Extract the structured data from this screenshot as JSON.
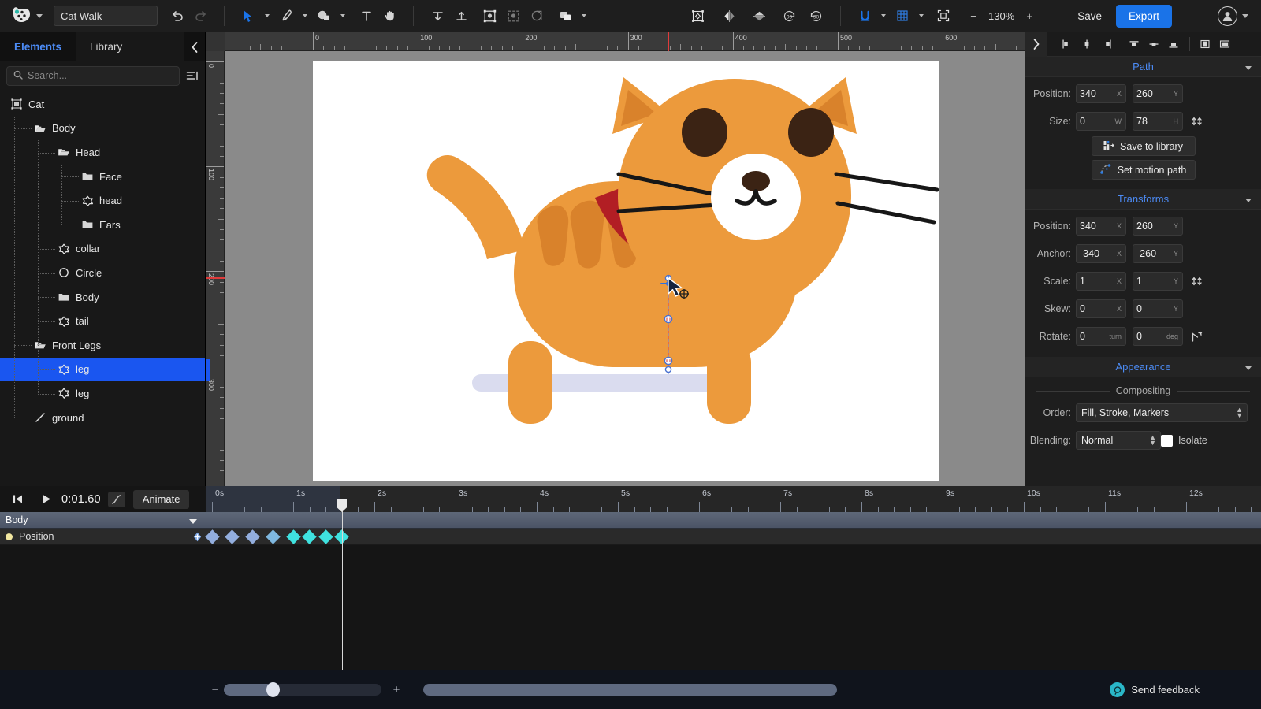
{
  "app": {
    "title": "Cat Walk",
    "logo_icon": "app-logo-icon"
  },
  "topbar": {
    "undo_icon": "undo-icon",
    "redo_icon": "redo-icon",
    "tools": [
      {
        "name": "select-tool",
        "icon": "cursor-arrow-icon",
        "has_caret": true
      },
      {
        "name": "pen-tool",
        "icon": "pen-nib-icon",
        "has_caret": true
      },
      {
        "name": "shape-tool",
        "icon": "shapes-icon",
        "has_caret": true
      },
      {
        "name": "text-tool",
        "icon": "text-T-icon",
        "has_caret": false
      },
      {
        "name": "hand-tool",
        "icon": "hand-icon",
        "has_caret": false
      }
    ],
    "arrange": [
      {
        "name": "align-top-tool",
        "icon": "align-top-icon"
      },
      {
        "name": "align-bottom-tool",
        "icon": "align-bottom-icon"
      },
      {
        "name": "group-tool",
        "icon": "group-frame-icon"
      },
      {
        "name": "ungroup-tool",
        "icon": "ungroup-icon"
      },
      {
        "name": "mask-tool",
        "icon": "mask-circle-icon"
      },
      {
        "name": "boolean-tool",
        "icon": "boolean-union-icon",
        "has_caret": true
      }
    ],
    "transform": [
      {
        "name": "transform-tool",
        "icon": "transform-box-icon"
      },
      {
        "name": "flip-horizontal-tool",
        "icon": "flip-horizontal-icon"
      },
      {
        "name": "flip-vertical-tool",
        "icon": "flip-vertical-icon"
      },
      {
        "name": "rotate-ccw-90-tool",
        "icon": "rotate-left-90-icon"
      },
      {
        "name": "rotate-cw-90-tool",
        "icon": "rotate-right-90-icon"
      }
    ],
    "snap": {
      "name": "snap-tool",
      "icon": "magnet-U-icon",
      "has_caret": true
    },
    "grid": {
      "name": "grid-tool",
      "icon": "grid-icon",
      "has_caret": true
    },
    "fit": {
      "name": "fit-to-screen-tool",
      "icon": "fit-screen-icon"
    },
    "zoom_out_label": "−",
    "zoom_level": "130%",
    "zoom_in_label": "+",
    "save_label": "Save",
    "export_label": "Export",
    "account_icon": "user-avatar-icon"
  },
  "sidebar": {
    "tabs": [
      {
        "label": "Elements",
        "active": true
      },
      {
        "label": "Library",
        "active": false
      }
    ],
    "collapse_icon": "chevron-left-icon",
    "search": {
      "placeholder": "Search...",
      "value": "",
      "icon": "search-icon"
    },
    "filter_icon": "filter-list-icon",
    "tree": [
      {
        "label": "Cat",
        "depth": 0,
        "icon": "artboard-icon",
        "selected": false
      },
      {
        "label": "Body",
        "depth": 1,
        "icon": "folder-open-icon",
        "selected": false
      },
      {
        "label": "Head",
        "depth": 2,
        "icon": "folder-open-icon",
        "selected": false
      },
      {
        "label": "Face",
        "depth": 3,
        "icon": "folder-icon",
        "selected": false
      },
      {
        "label": "head",
        "depth": 3,
        "icon": "path-star-icon",
        "selected": false
      },
      {
        "label": "Ears",
        "depth": 3,
        "icon": "folder-icon",
        "selected": false
      },
      {
        "label": "collar",
        "depth": 2,
        "icon": "path-star-icon",
        "selected": false
      },
      {
        "label": "Circle",
        "depth": 2,
        "icon": "circle-icon",
        "selected": false
      },
      {
        "label": "Body",
        "depth": 2,
        "icon": "folder-icon",
        "selected": false
      },
      {
        "label": "tail",
        "depth": 2,
        "icon": "path-star-icon",
        "selected": false
      },
      {
        "label": "Front Legs",
        "depth": 1,
        "icon": "folder-open-icon",
        "selected": false
      },
      {
        "label": "leg",
        "depth": 2,
        "icon": "path-star-icon",
        "selected": true
      },
      {
        "label": "leg",
        "depth": 2,
        "icon": "path-star-icon",
        "selected": false
      },
      {
        "label": "ground",
        "depth": 1,
        "icon": "line-icon",
        "selected": false
      }
    ]
  },
  "canvas": {
    "ruler_h_labels": [
      "0",
      "100",
      "200",
      "300",
      "400",
      "500",
      "600"
    ],
    "ruler_v_labels": [
      "0",
      "100",
      "200",
      "300"
    ],
    "background_color": "#8a8a8a",
    "artboard_color": "#ffffff",
    "guide_color": "#e03b3b"
  },
  "artwork": {
    "name": "cat-illustration",
    "colors": {
      "body": "#EC9A3C",
      "stripe": "#D9822B",
      "ear_inner": "#D9822B",
      "muzzle": "#FFFFFF",
      "eye": "#3B2314",
      "nose": "#3B2314",
      "collar": "#B21E24",
      "bell": "#FFD53E",
      "ground_shadow": "#DADCEF",
      "whisker": "#171717"
    }
  },
  "properties": {
    "panel_toolbar": {
      "expand_icon": "chevron-right-icon",
      "align_buttons": [
        {
          "name": "align-left-icon"
        },
        {
          "name": "align-center-horizontal-icon"
        },
        {
          "name": "align-right-icon"
        },
        {
          "name": "align-top-icon"
        },
        {
          "name": "align-middle-vertical-icon"
        },
        {
          "name": "align-bottom-icon"
        },
        {
          "name": "distribute-horizontal-icon"
        },
        {
          "name": "distribute-vertical-icon"
        }
      ]
    },
    "path": {
      "title": "Path",
      "position_label": "Position:",
      "position_x": "340",
      "position_x_unit": "X",
      "position_y": "260",
      "position_y_unit": "Y",
      "size_label": "Size:",
      "size_w": "0",
      "size_w_unit": "W",
      "size_h": "78",
      "size_h_unit": "H",
      "link_icon": "link-ratio-icon",
      "save_to_library_label": "Save to library",
      "save_to_library_icon": "save-library-icon",
      "set_motion_path_label": "Set motion path",
      "set_motion_path_icon": "motion-path-icon"
    },
    "transforms": {
      "title": "Transforms",
      "position_label": "Position:",
      "position_x": "340",
      "position_x_unit": "X",
      "position_y": "260",
      "position_y_unit": "Y",
      "anchor_label": "Anchor:",
      "anchor_x": "-340",
      "anchor_x_unit": "X",
      "anchor_y": "-260",
      "anchor_y_unit": "Y",
      "scale_label": "Scale:",
      "scale_x": "1",
      "scale_x_unit": "X",
      "scale_y": "1",
      "scale_y_unit": "Y",
      "scale_link_icon": "link-ratio-icon",
      "skew_label": "Skew:",
      "skew_x": "0",
      "skew_x_unit": "X",
      "skew_y": "0",
      "skew_y_unit": "Y",
      "rotate_label": "Rotate:",
      "rotate_turn": "0",
      "rotate_turn_unit": "turn",
      "rotate_deg": "0",
      "rotate_deg_unit": "deg",
      "rotate_icon": "rotate-anchor-icon"
    },
    "appearance": {
      "title": "Appearance",
      "compositing_label": "Compositing",
      "order_label": "Order:",
      "order_value": "Fill, Stroke, Markers",
      "blending_label": "Blending:",
      "blending_value": "Normal",
      "isolate_label": "Isolate",
      "isolate_checked": false
    }
  },
  "timeline": {
    "skip_start_icon": "skip-to-start-icon",
    "play_icon": "play-icon",
    "timecode": "0:01.60",
    "easing_icon": "easing-curve-icon",
    "animate_label": "Animate",
    "ruler_labels": [
      "0s",
      "1s",
      "2s",
      "3s",
      "4s",
      "5s",
      "6s",
      "7s",
      "8s",
      "9s",
      "10s",
      "11s",
      "12s"
    ],
    "playhead_time": "1.60",
    "group_track": {
      "label": "Body",
      "collapse_icon": "chevron-down-icon"
    },
    "property_track": {
      "label": "Position",
      "dot_color": "#f2e7a0",
      "nav_icon": "keyframe-nav-icon",
      "keyframes": [
        {
          "t": 0.0,
          "color": "#93aede"
        },
        {
          "t": 0.25,
          "color": "#93aede"
        },
        {
          "t": 0.5,
          "color": "#93aede"
        },
        {
          "t": 0.75,
          "color": "#7fb8e0"
        },
        {
          "t": 1.0,
          "color": "#3fe2e0"
        },
        {
          "t": 1.2,
          "color": "#3fe2e0"
        },
        {
          "t": 1.4,
          "color": "#3fe2e0"
        },
        {
          "t": 1.6,
          "color": "#3fe2e0"
        }
      ]
    }
  },
  "bottombar": {
    "zoom_out_label": "−",
    "zoom_in_label": "+",
    "zoom_value": 31,
    "hscroll_value": 100,
    "feedback_label": "Send feedback",
    "feedback_icon": "feedback-chat-icon"
  }
}
